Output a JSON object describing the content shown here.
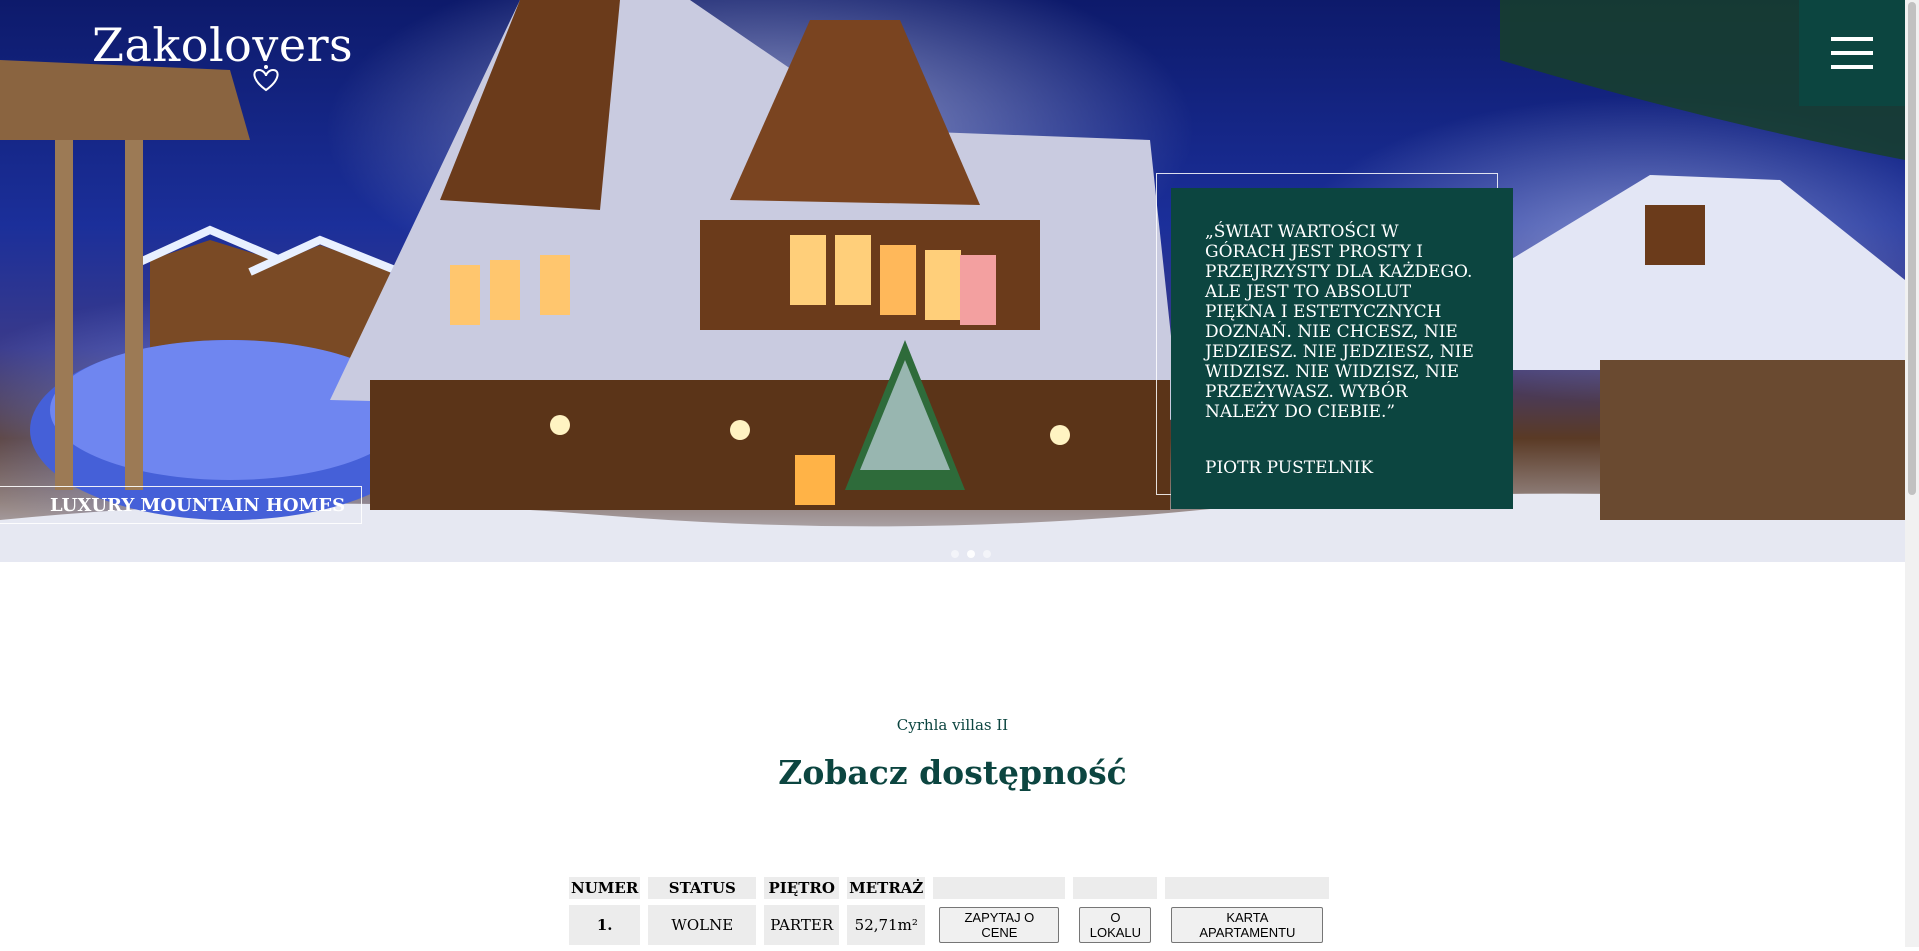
{
  "brand": {
    "logo_text": "Zakolovers"
  },
  "hero": {
    "tagline": "LUXURY MOUNTAIN HOMES",
    "quote_text": "„ŚWIAT WARTOŚCI W GÓRACH JEST PROSTY I PRZEJRZYSTY DLA KAŻDEGO. ALE JEST TO ABSOLUT PIĘKNA I ESTETYCZNYCH DOZNAŃ. NIE CHCESZ, NIE JEDZIESZ. NIE JEDZIESZ, NIE WIDZISZ. NIE WIDZISZ, NIE PRZEŻYWASZ. WYBÓR NALEŻY DO CIEBIE.”",
    "quote_author": "PIOTR PUSTELNIK",
    "slide_count": 3,
    "active_slide": 1
  },
  "section": {
    "subtitle": "Cyrhla villas II",
    "title": "Zobacz dostępność"
  },
  "table": {
    "headers": [
      "NUMER",
      "STATUS",
      "PIĘTRO",
      "METRAŻ",
      "",
      "",
      ""
    ],
    "rows": [
      {
        "numer": "1.",
        "status": "WOLNE",
        "pietro": "PARTER",
        "metraz": "52,71m²",
        "ask_price_label": "ZAPYTAJ O CENE",
        "about_label": "O LOKALU",
        "card_label": "KARTA APARTAMENTU"
      }
    ]
  },
  "colors": {
    "brand_green": "#0c4540",
    "header_cell_bg": "#ececec"
  },
  "icons": {
    "menu": "hamburger-icon",
    "logo_mark": "heart-ornament-icon"
  }
}
